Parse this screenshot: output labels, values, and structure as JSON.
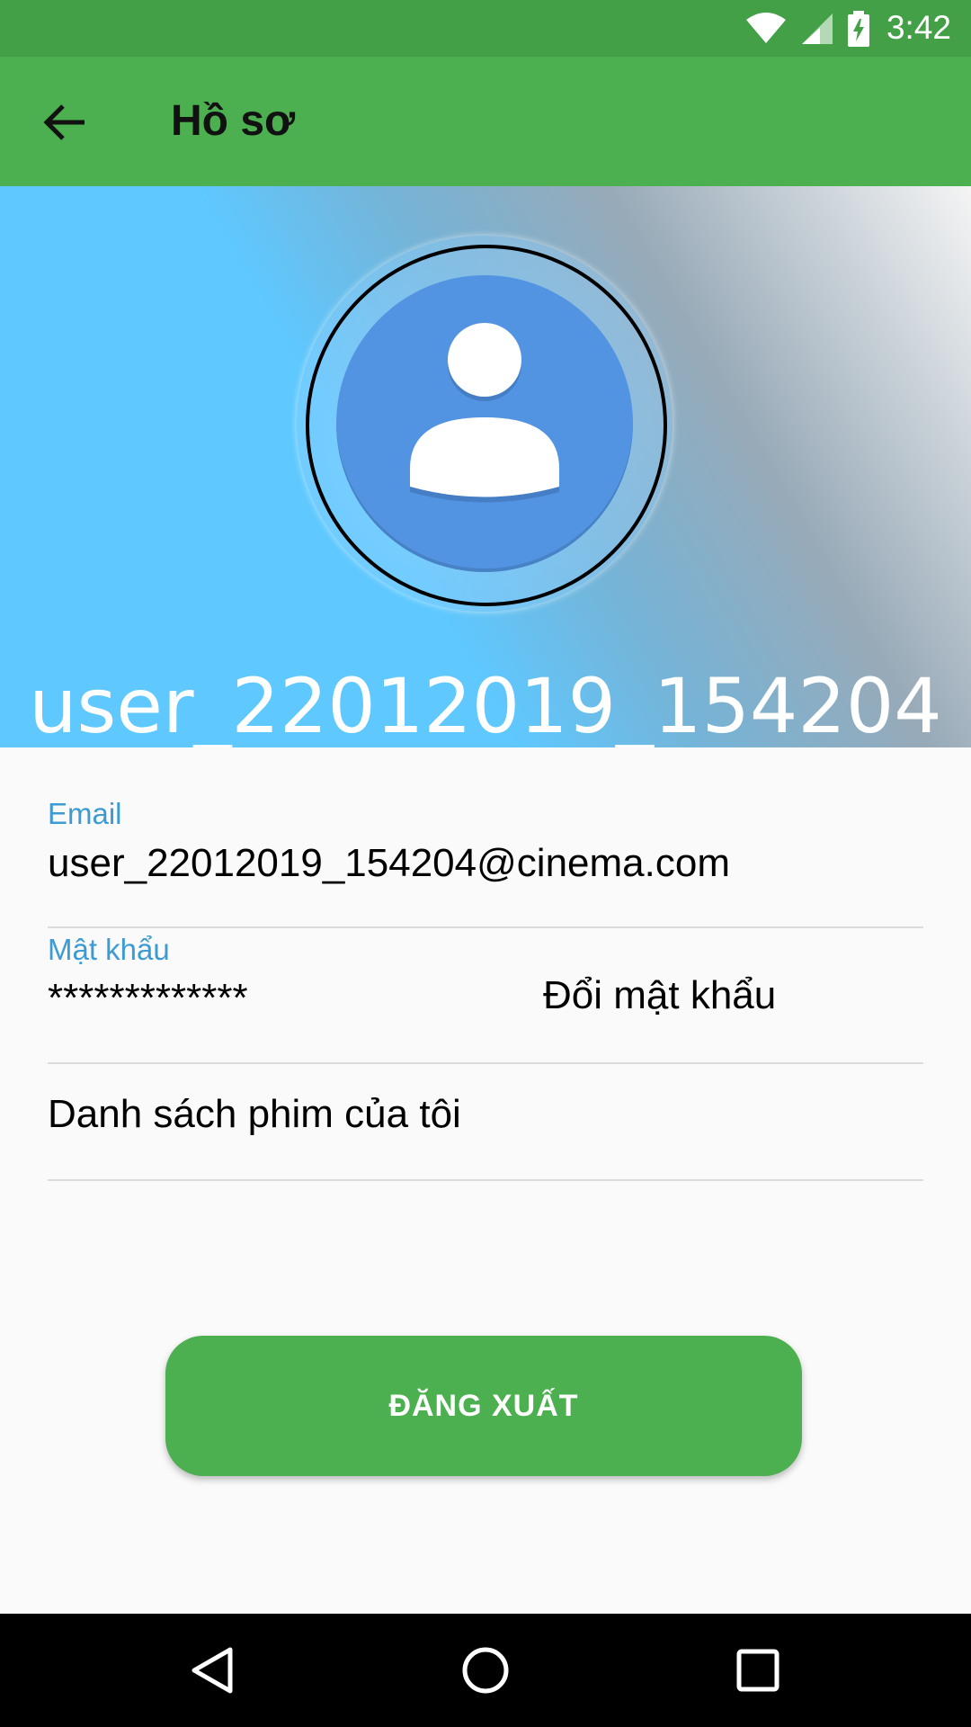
{
  "status_bar": {
    "time": "3:42",
    "icons": [
      "wifi-icon",
      "cell-signal-icon",
      "battery-charging-icon"
    ]
  },
  "app_bar": {
    "title": "Hồ sơ",
    "back_icon": "arrow-back-icon"
  },
  "header": {
    "username": "user_22012019_154204",
    "avatar_icon": "person-icon"
  },
  "profile": {
    "email_label": "Email",
    "email_value": "user_22012019_154204@cinema.com",
    "password_label": "Mật khẩu",
    "password_value": "*************",
    "change_password_label": "Đổi mật khẩu",
    "my_movies_label": "Danh sách phim của tôi"
  },
  "logout_label": "ĐĂNG XUẤT",
  "nav_bar": {
    "icons": [
      "back-triangle-icon",
      "home-circle-icon",
      "recents-square-icon"
    ]
  },
  "colors": {
    "app_bar": "#4caf50",
    "status_bar": "#43a047",
    "accent_label": "#3d9bd3",
    "avatar": "#5294e2",
    "header_blue": "#5ec8ff"
  }
}
